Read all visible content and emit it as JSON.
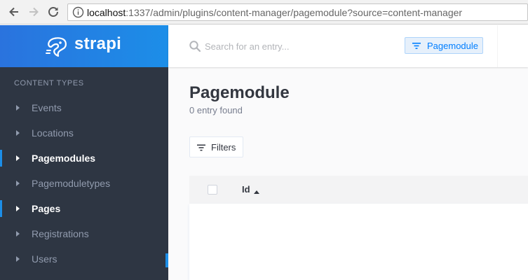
{
  "browser": {
    "url_host": "localhost",
    "url_rest": ":1337/admin/plugins/content-manager/pagemodule?source=content-manager"
  },
  "brand": {
    "name": "strapi"
  },
  "sidebar": {
    "section_title": "CONTENT TYPES",
    "items": [
      {
        "label": "Events",
        "active": false
      },
      {
        "label": "Locations",
        "active": false
      },
      {
        "label": "Pagemodules",
        "active": true
      },
      {
        "label": "Pagemoduletypes",
        "active": false
      },
      {
        "label": "Pages",
        "active": true
      },
      {
        "label": "Registrations",
        "active": false
      },
      {
        "label": "Users",
        "active": false
      }
    ]
  },
  "header": {
    "search_placeholder": "Search for an entry...",
    "tag_label": "Pagemodule"
  },
  "main": {
    "title": "Pagemodule",
    "entry_count": "0 entry found",
    "filters_label": "Filters",
    "table": {
      "columns": [
        "Id"
      ]
    }
  },
  "colors": {
    "brand_gradient_start": "#2a73de",
    "brand_gradient_end": "#1c8ee8",
    "sidebar_bg": "#2e3643",
    "accent": "#1c8ee8",
    "tag_text": "#007eff"
  }
}
